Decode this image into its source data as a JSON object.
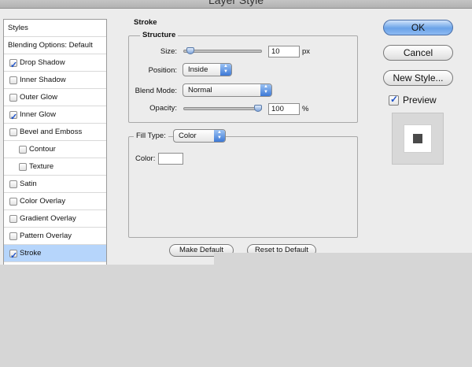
{
  "window": {
    "title": "Layer Style"
  },
  "sidebar": {
    "header": "Styles",
    "blending": "Blending Options: Default",
    "items": [
      {
        "label": "Drop Shadow",
        "checked": true,
        "indent": false,
        "selected": false
      },
      {
        "label": "Inner Shadow",
        "checked": false,
        "indent": false,
        "selected": false
      },
      {
        "label": "Outer Glow",
        "checked": false,
        "indent": false,
        "selected": false
      },
      {
        "label": "Inner Glow",
        "checked": true,
        "indent": false,
        "selected": false
      },
      {
        "label": "Bevel and Emboss",
        "checked": false,
        "indent": false,
        "selected": false
      },
      {
        "label": "Contour",
        "checked": false,
        "indent": true,
        "selected": false
      },
      {
        "label": "Texture",
        "checked": false,
        "indent": true,
        "selected": false
      },
      {
        "label": "Satin",
        "checked": false,
        "indent": false,
        "selected": false
      },
      {
        "label": "Color Overlay",
        "checked": false,
        "indent": false,
        "selected": false
      },
      {
        "label": "Gradient Overlay",
        "checked": false,
        "indent": false,
        "selected": false
      },
      {
        "label": "Pattern Overlay",
        "checked": false,
        "indent": false,
        "selected": false
      },
      {
        "label": "Stroke",
        "checked": true,
        "indent": false,
        "selected": true
      }
    ]
  },
  "stroke": {
    "title": "Stroke",
    "structure": {
      "title": "Structure",
      "size_label": "Size:",
      "size_value": "10",
      "size_unit": "px",
      "size_level": 0.04,
      "position_label": "Position:",
      "position_value": "Inside",
      "blend_label": "Blend Mode:",
      "blend_value": "Normal",
      "opacity_label": "Opacity:",
      "opacity_value": "100",
      "opacity_unit": "%",
      "opacity_level": 1.0
    },
    "fill": {
      "type_label": "Fill Type:",
      "type_value": "Color",
      "color_label": "Color:",
      "color_value": "#ffffff"
    },
    "make_default": "Make Default",
    "reset_default": "Reset to Default"
  },
  "buttons": {
    "ok": "OK",
    "cancel": "Cancel",
    "new_style": "New Style..."
  },
  "preview": {
    "label": "Preview",
    "checked": true
  }
}
